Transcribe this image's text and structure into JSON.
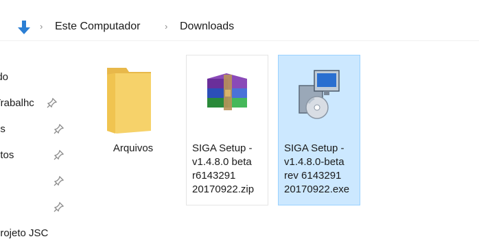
{
  "address_bar": {
    "icon": "download-arrow-icon",
    "separator": "›",
    "breadcrumbs": [
      "Este Computador",
      "Downloads"
    ]
  },
  "nav_pane": {
    "items": [
      {
        "label": "ido",
        "pinned": false
      },
      {
        "label": "Trabalhc",
        "pinned": true
      },
      {
        "label": "ds",
        "pinned": true
      },
      {
        "label": "ntos",
        "pinned": true
      },
      {
        "label": "",
        "pinned": true
      },
      {
        "label": "",
        "pinned": true
      },
      {
        "label": "projeto JSC",
        "pinned": false
      }
    ]
  },
  "files": [
    {
      "name": "Arquivos",
      "type": "folder",
      "icon": "folder-icon",
      "selected": false
    },
    {
      "name": "SIGA Setup -\nv1.4.8.0 beta\nr6143291\n20170922.zip",
      "type": "zip",
      "icon": "winrar-archive-icon",
      "selected": false
    },
    {
      "name": "SIGA Setup -\nv1.4.8.0-beta\nrev 6143291\n20170922.exe",
      "type": "exe",
      "icon": "setup-installer-icon",
      "selected": true
    }
  ],
  "colors": {
    "selection_bg": "#cce8ff",
    "selection_border": "#99d1ff",
    "folder": "#f6d26a",
    "download_arrow": "#2b7fd4"
  }
}
